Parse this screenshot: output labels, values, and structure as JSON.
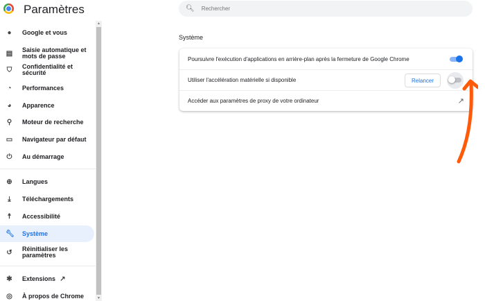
{
  "app": {
    "title": "Paramètres"
  },
  "search": {
    "placeholder": "Rechercher"
  },
  "sidebar": {
    "items": [
      {
        "label": "Google et vous",
        "icon": "person-icon"
      },
      {
        "label": "Saisie automatique et mots de passe",
        "icon": "clipboard-icon"
      },
      {
        "label": "Confidentialité et sécurité",
        "icon": "shield-icon"
      },
      {
        "label": "Performances",
        "icon": "speedometer-icon"
      },
      {
        "label": "Apparence",
        "icon": "palette-icon"
      },
      {
        "label": "Moteur de recherche",
        "icon": "search-icon"
      },
      {
        "label": "Navigateur par défaut",
        "icon": "browser-icon"
      },
      {
        "label": "Au démarrage",
        "icon": "power-icon"
      },
      {
        "label": "Langues",
        "icon": "globe-icon"
      },
      {
        "label": "Téléchargements",
        "icon": "download-icon"
      },
      {
        "label": "Accessibilité",
        "icon": "accessibility-icon"
      },
      {
        "label": "Système",
        "icon": "wrench-icon"
      },
      {
        "label": "Réinitialiser les paramètres",
        "icon": "history-icon"
      },
      {
        "label": "Extensions",
        "icon": "puzzle-icon"
      },
      {
        "label": "À propos de Chrome",
        "icon": "chrome-icon"
      }
    ]
  },
  "main": {
    "section_title": "Système",
    "rows": [
      {
        "label": "Poursuivre l'exécution d'applications en arrière-plan après la fermeture de Google Chrome",
        "toggle": true
      },
      {
        "label": "Utiliser l'accélération matérielle si disponible",
        "toggle": false,
        "button": "Relancer"
      },
      {
        "label": "Accéder aux paramètres de proxy de votre ordinateur"
      }
    ]
  },
  "colors": {
    "accent": "#1a73e8",
    "annotation": "#ff5a0a"
  }
}
